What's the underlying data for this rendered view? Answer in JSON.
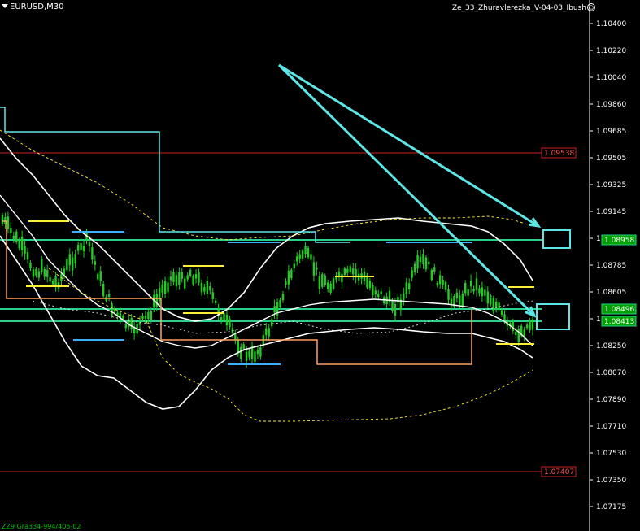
{
  "header": {
    "symbol_title": "EURUSD,M30",
    "ea_name": "Ze_33_Zhuravlerezka_V-04-03_Ibush"
  },
  "price_axis": {
    "ticks": [
      "1.10400",
      "1.10220",
      "1.10040",
      "1.09860",
      "1.09685",
      "1.09505",
      "1.09325",
      "1.09145",
      "1.08965",
      "1.08785",
      "1.08605",
      "1.08425",
      "1.08250",
      "1.08070",
      "1.07890",
      "1.07710",
      "1.07530",
      "1.07350",
      "1.07175"
    ]
  },
  "price_labels": [
    {
      "name": "upper-red-level",
      "text": "1.09538",
      "style": "red"
    },
    {
      "name": "upper-green-level",
      "text": "1.08958",
      "style": "green"
    },
    {
      "name": "middle-green-level",
      "text": "1.08496",
      "style": "green"
    },
    {
      "name": "lower-green-level",
      "text": "1.08413",
      "style": "green"
    },
    {
      "name": "lower-red-level",
      "text": "1.07407",
      "style": "red"
    }
  ],
  "footer": {
    "text": "ZZ9 Gra334-994/405-02"
  },
  "colors": {
    "background": "#000000",
    "axis_text": "#ffffff",
    "red_level": "#cc2222",
    "green_level": "#2ad08a",
    "cyan": "#5ee6e6",
    "candles": "#22cc22",
    "bands": "#ffffff",
    "yellow": "#ffee33",
    "orange": "#ffa060",
    "label_red_bg": "#000000",
    "label_green_bg": "#00a000"
  }
}
